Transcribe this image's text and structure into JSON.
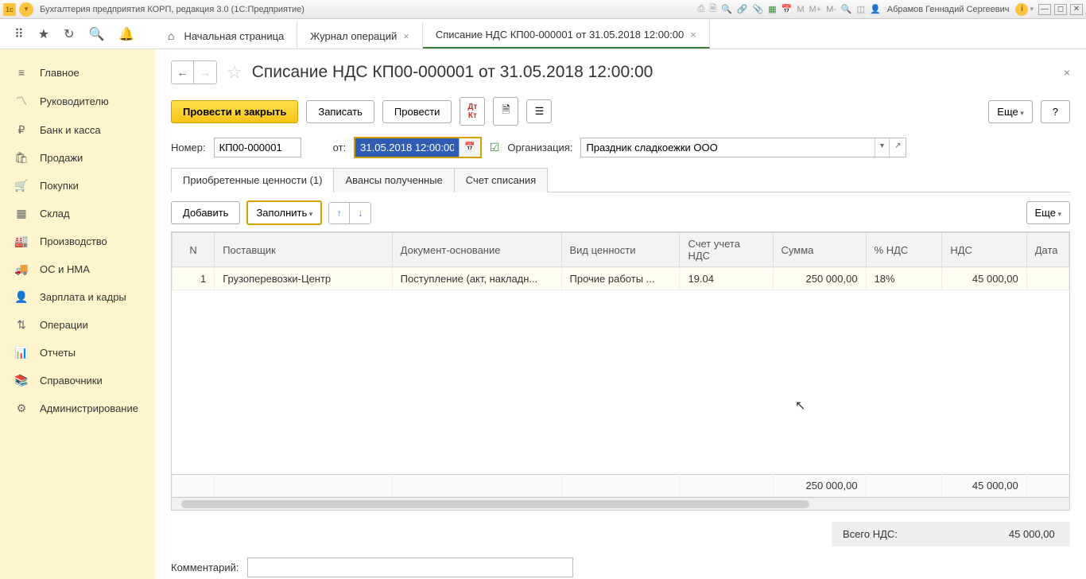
{
  "titlebar": {
    "app_title": "Бухгалтерия предприятия КОРП, редакция 3.0  (1С:Предприятие)",
    "user": "Абрамов Геннадий Сергеевич",
    "m_labels": [
      "M",
      "M+",
      "M-"
    ]
  },
  "topnav": {
    "tabs": [
      {
        "label": "Начальная страница",
        "closable": false,
        "icon": "home"
      },
      {
        "label": "Журнал операций",
        "closable": true
      },
      {
        "label": "Списание НДС КП00-000001 от 31.05.2018 12:00:00",
        "closable": true,
        "active": true
      }
    ]
  },
  "sidebar": {
    "items": [
      {
        "label": "Главное",
        "icon": "≡"
      },
      {
        "label": "Руководителю",
        "icon": "〽"
      },
      {
        "label": "Банк и касса",
        "icon": "₽"
      },
      {
        "label": "Продажи",
        "icon": "🛍"
      },
      {
        "label": "Покупки",
        "icon": "🛒"
      },
      {
        "label": "Склад",
        "icon": "▦"
      },
      {
        "label": "Производство",
        "icon": "🏭"
      },
      {
        "label": "ОС и НМА",
        "icon": "🚚"
      },
      {
        "label": "Зарплата и кадры",
        "icon": "👤"
      },
      {
        "label": "Операции",
        "icon": "⇅"
      },
      {
        "label": "Отчеты",
        "icon": "📊"
      },
      {
        "label": "Справочники",
        "icon": "📚"
      },
      {
        "label": "Администрирование",
        "icon": "⚙"
      }
    ]
  },
  "doc": {
    "title": "Списание НДС КП00-000001 от 31.05.2018 12:00:00",
    "toolbar": {
      "post_close": "Провести и закрыть",
      "write": "Записать",
      "post": "Провести",
      "more": "Еще",
      "help": "?"
    },
    "fields": {
      "number_label": "Номер:",
      "number": "КП00-000001",
      "date_label": "от:",
      "date": "31.05.2018 12:00:00",
      "org_label": "Организация:",
      "org": "Праздник сладкоежки ООО"
    },
    "subtabs": [
      "Приобретенные ценности (1)",
      "Авансы полученные",
      "Счет списания"
    ],
    "tab_toolbar": {
      "add": "Добавить",
      "fill": "Заполнить",
      "more": "Еще"
    },
    "table": {
      "columns": [
        "N",
        "Поставщик",
        "Документ-основание",
        "Вид ценности",
        "Счет учета НДС",
        "Сумма",
        "% НДС",
        "НДС",
        "Дата"
      ],
      "rows": [
        {
          "n": "1",
          "supplier": "Грузоперевозки-Центр",
          "doc": "Поступление (акт, накладн...",
          "type": "Прочие работы ...",
          "acct": "19.04",
          "sum": "250 000,00",
          "pct": "18%",
          "nds": "45 000,00",
          "date": ""
        }
      ],
      "footer": {
        "sum": "250 000,00",
        "nds": "45 000,00"
      }
    },
    "total": {
      "label": "Всего НДС:",
      "value": "45 000,00"
    },
    "comment_label": "Комментарий:",
    "comment": ""
  }
}
